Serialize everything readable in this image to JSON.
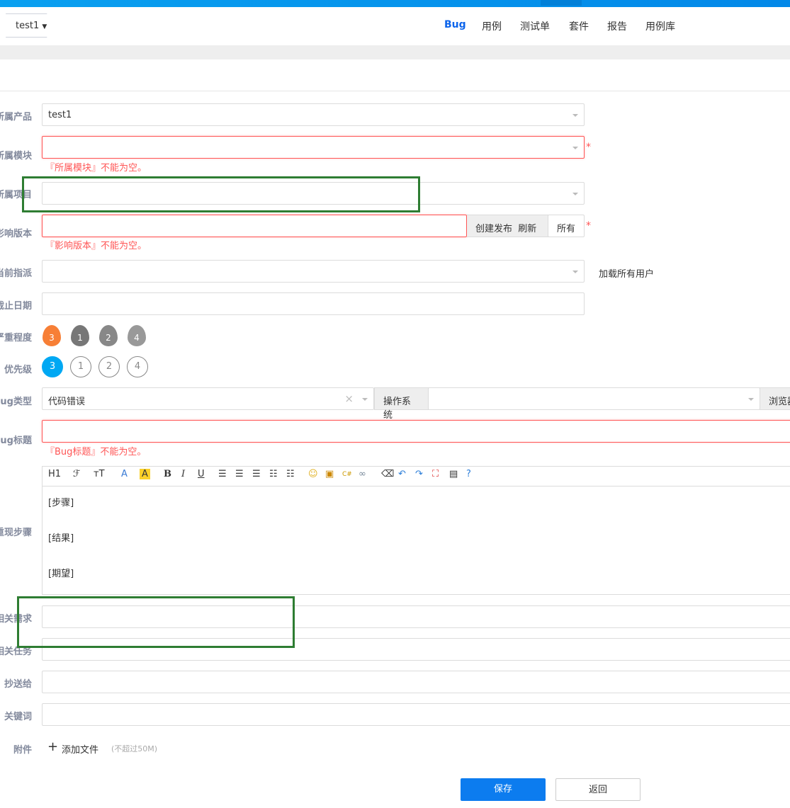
{
  "header": {
    "product": "test1",
    "nav": [
      "Bug",
      "用例",
      "测试单",
      "套件",
      "报告",
      "用例库"
    ]
  },
  "form": {
    "product": {
      "label": "所属产品",
      "value": "test1"
    },
    "module": {
      "label": "所属模块",
      "error": "『所属模块』不能为空。"
    },
    "project": {
      "label": "所属项目"
    },
    "build": {
      "label": "影响版本",
      "error": "『影响版本』不能为空。",
      "create": "创建发布",
      "refresh": "刷新",
      "all": "所有"
    },
    "assign": {
      "label": "当前指派",
      "load_all": "加载所有用户"
    },
    "deadline": {
      "label": "截止日期"
    },
    "severity": {
      "label": "严重程度",
      "options": [
        "3",
        "1",
        "2",
        "4"
      ],
      "selected": "3"
    },
    "priority": {
      "label": "优先级",
      "options": [
        "3",
        "1",
        "2",
        "4"
      ],
      "selected": "3"
    },
    "type": {
      "label": "Bug类型",
      "value": "代码错误",
      "os_label": "操作系统",
      "browser_label": "浏览器"
    },
    "title": {
      "label": "Bug标题",
      "error": "『Bug标题』不能为空。"
    },
    "steps": {
      "label": "重现步骤",
      "lines": [
        "[步骤]",
        "[结果]",
        "[期望]"
      ]
    },
    "story": {
      "label": "相关需求"
    },
    "task": {
      "label": "相关任务"
    },
    "mailto": {
      "label": "抄送给"
    },
    "keywords": {
      "label": "关键词"
    },
    "files": {
      "label": "附件",
      "add": "添加文件",
      "limit": "(不超过50M)"
    }
  },
  "toolbar": {
    "h1": "H1",
    "font": "ℱ",
    "size": "тT",
    "color": "A",
    "bg": "A",
    "bold": "B",
    "italic": "I",
    "underline": "U"
  },
  "actions": {
    "save": "保存",
    "back": "返回"
  },
  "colors": {
    "accent": "#0c64eb",
    "error": "#ff5555",
    "primary_btn": "#0c7cef"
  }
}
